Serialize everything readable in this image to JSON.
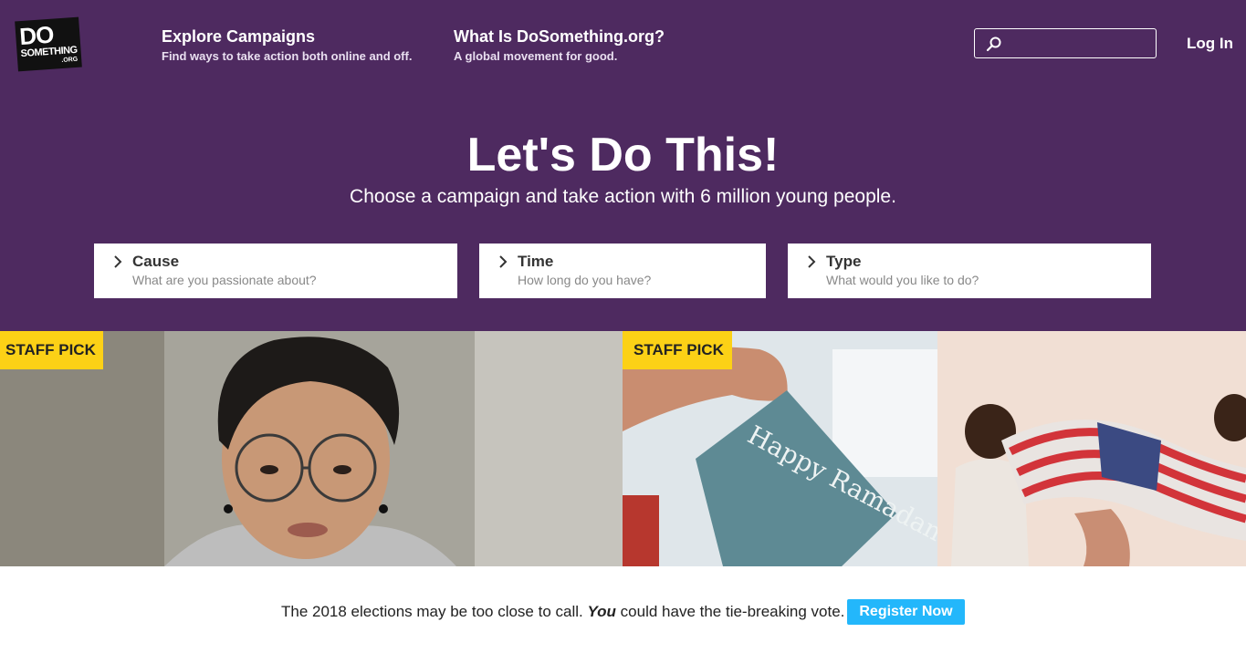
{
  "logo": {
    "line1": "DO",
    "line2": "SOMETHING",
    "line3": ".ORG"
  },
  "nav": [
    {
      "title": "Explore Campaigns",
      "subtitle": "Find ways to take action both online and off."
    },
    {
      "title": "What Is DoSomething.org?",
      "subtitle": "A global movement for good."
    }
  ],
  "search": {
    "placeholder": "",
    "icon": "search-icon"
  },
  "login_label": "Log In",
  "hero": {
    "headline": "Let's Do This!",
    "subhead": "Choose a campaign and take action with 6 million young people."
  },
  "filters": [
    {
      "title": "Cause",
      "subtitle": "What are you passionate about?"
    },
    {
      "title": "Time",
      "subtitle": "How long do you have?"
    },
    {
      "title": "Type",
      "subtitle": "What would you like to do?"
    }
  ],
  "tiles": {
    "badge_label": "STAFF PICK",
    "image_text": "Happy Ramadan!!"
  },
  "banner": {
    "text_before": "The 2018 elections may be too close to call. ",
    "text_emphasis": "You",
    "text_after": " could have the tie-breaking vote.",
    "button_label": "Register Now"
  },
  "colors": {
    "hero_bg": "#4e2a60",
    "badge_bg": "#fcd116",
    "register_bg": "#23b7fb"
  }
}
